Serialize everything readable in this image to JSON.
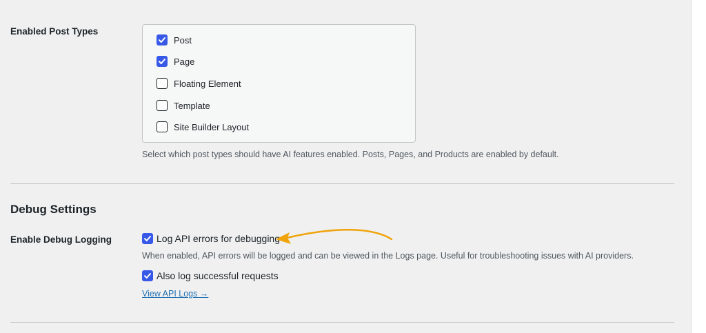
{
  "post_types": {
    "label": "Enabled Post Types",
    "options": [
      {
        "label": "Post",
        "checked": true
      },
      {
        "label": "Page",
        "checked": true
      },
      {
        "label": "Floating Element",
        "checked": false
      },
      {
        "label": "Template",
        "checked": false
      },
      {
        "label": "Site Builder Layout",
        "checked": false
      }
    ],
    "description": "Select which post types should have AI features enabled. Posts, Pages, and Products are enabled by default."
  },
  "debug": {
    "section_title": "Debug Settings",
    "label": "Enable Debug Logging",
    "log_errors": {
      "label": "Log API errors for debugging",
      "checked": true
    },
    "log_errors_description": "When enabled, API errors will be logged and can be viewed in the Logs page. Useful for troubleshooting issues with AI providers.",
    "log_success": {
      "label": "Also log successful requests",
      "checked": true
    },
    "logs_link": "View API Logs →"
  },
  "colors": {
    "accent": "#3858e9",
    "annotation_arrow": "#f0a30a",
    "link": "#2271b1"
  }
}
